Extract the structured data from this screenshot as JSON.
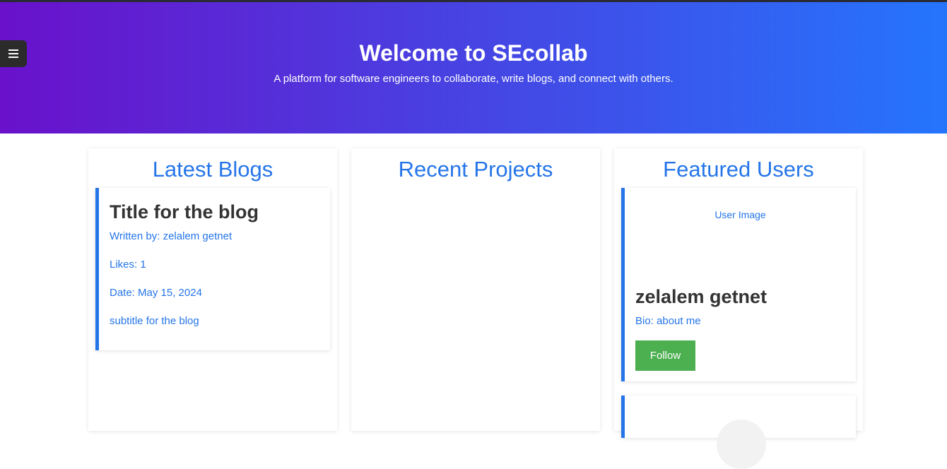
{
  "hero": {
    "title": "Welcome to SEcollab",
    "subtitle": "A platform for software engineers to collaborate, write blogs, and connect with others."
  },
  "menu": {
    "icon": "hamburger-menu-icon"
  },
  "blogs": {
    "heading": "Latest Blogs",
    "items": [
      {
        "title": "Title for the blog",
        "author": "Written by: zelalem getnet",
        "likes": "Likes: 1",
        "date": "Date: May 15, 2024",
        "subtitle": "subtitle for the blog"
      }
    ]
  },
  "projects": {
    "heading": "Recent Projects"
  },
  "users": {
    "heading": "Featured Users",
    "items": [
      {
        "image_alt": "User Image",
        "name": "zelalem getnet",
        "bio": "Bio: about me",
        "follow_label": "Follow"
      }
    ]
  },
  "colors": {
    "hero_gradient_start": "#6a11cb",
    "hero_gradient_end": "#2575fc",
    "accent": "#2575e8",
    "follow_button": "#4caf50",
    "heading_text": "#333333"
  }
}
